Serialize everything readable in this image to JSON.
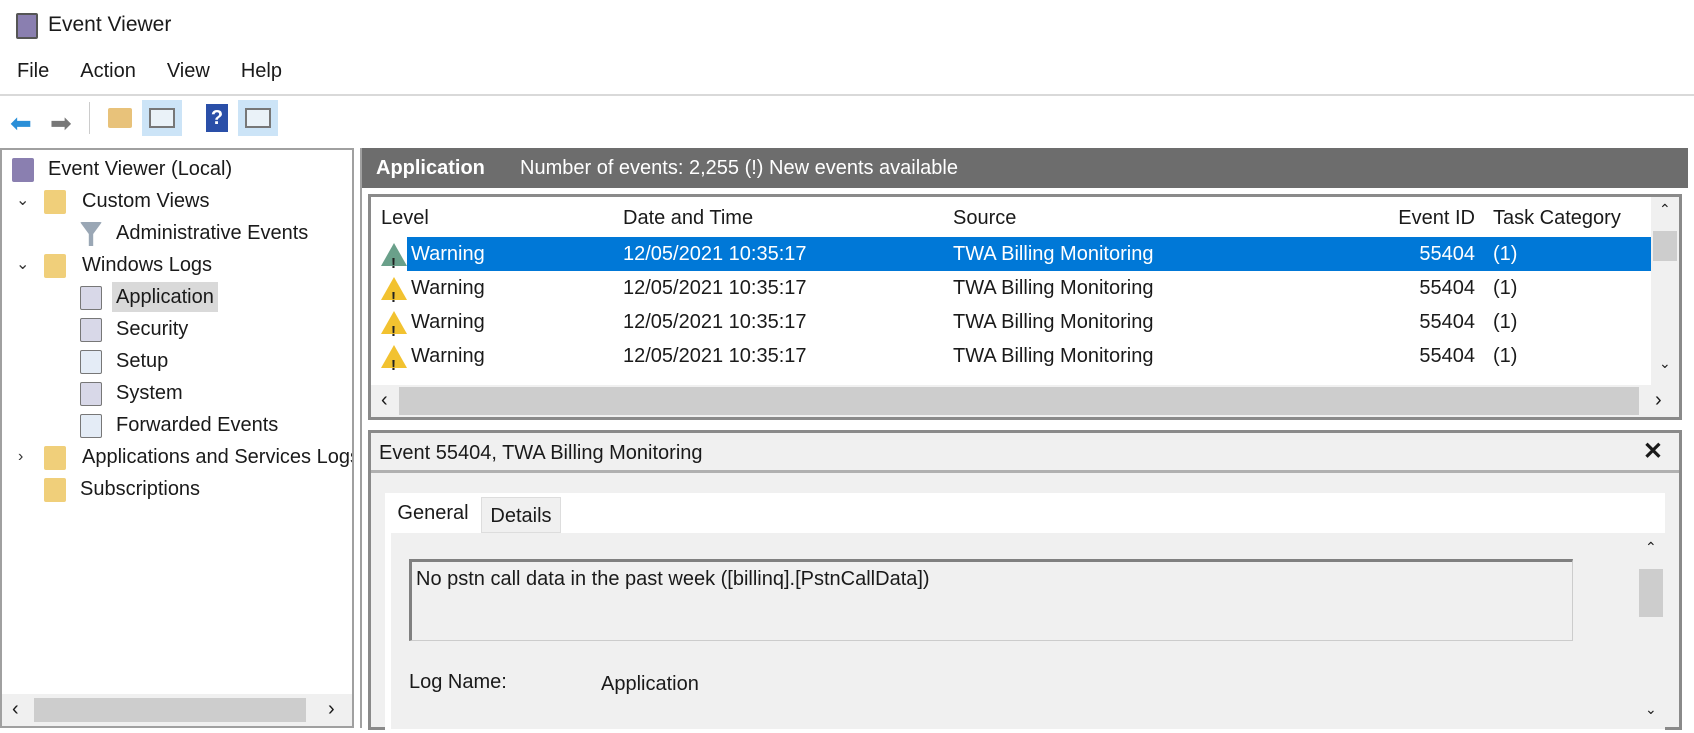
{
  "window": {
    "title": "Event Viewer"
  },
  "menu": [
    "File",
    "Action",
    "View",
    "Help"
  ],
  "toolbar": {
    "icons": [
      "back-arrow-icon",
      "forward-arrow-icon",
      "open-folder-icon",
      "show-hide-tree-icon",
      "help-icon",
      "show-hide-action-pane-icon"
    ]
  },
  "tree": {
    "root": "Event Viewer (Local)",
    "custom_views": "Custom Views",
    "administrative_events": "Administrative Events",
    "windows_logs": "Windows Logs",
    "application": "Application",
    "security": "Security",
    "setup": "Setup",
    "system": "System",
    "forwarded_events": "Forwarded Events",
    "apps_services": "Applications and Services Logs",
    "subscriptions": "Subscriptions"
  },
  "header": {
    "log_name": "Application",
    "info": "Number of events: 2,255 (!) New events available"
  },
  "columns": [
    "Level",
    "Date and Time",
    "Source",
    "Event ID",
    "Task Category"
  ],
  "rows": [
    {
      "level": "Warning",
      "date": "12/05/2021 10:35:17",
      "source": "TWA Billing Monitoring",
      "event_id": "55404",
      "task": "(1)"
    },
    {
      "level": "Warning",
      "date": "12/05/2021 10:35:17",
      "source": "TWA Billing Monitoring",
      "event_id": "55404",
      "task": "(1)"
    },
    {
      "level": "Warning",
      "date": "12/05/2021 10:35:17",
      "source": "TWA Billing Monitoring",
      "event_id": "55404",
      "task": "(1)"
    },
    {
      "level": "Warning",
      "date": "12/05/2021 10:35:17",
      "source": "TWA Billing Monitoring",
      "event_id": "55404",
      "task": "(1)"
    }
  ],
  "detail": {
    "title": "Event 55404, TWA Billing Monitoring",
    "tabs": [
      "General",
      "Details"
    ],
    "message": "No pstn call data in the past week ([billinq].[PstnCallData])",
    "log_name_label": "Log Name:",
    "log_name_value": "Application"
  },
  "colors": {
    "selection": "#0078d7",
    "header_bg": "#6d6d6d"
  }
}
